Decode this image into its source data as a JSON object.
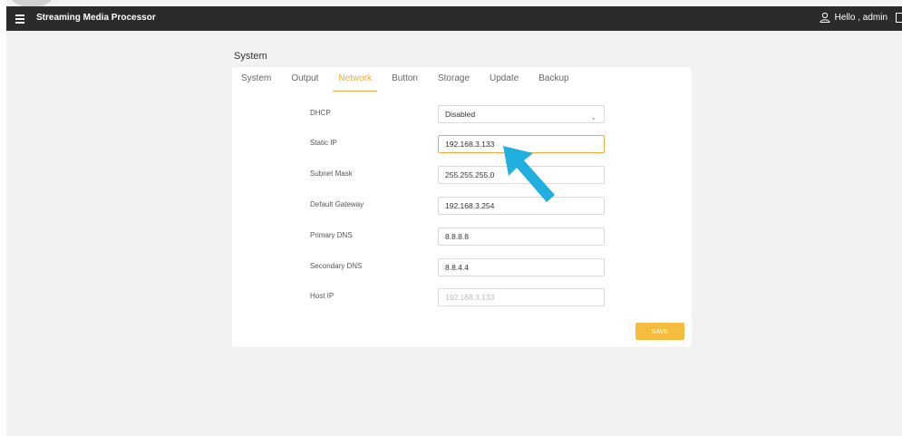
{
  "app": {
    "title": "Streaming Media Processor",
    "greeting": "Hello , admin"
  },
  "page": {
    "title": "System"
  },
  "tabs": [
    {
      "label": "System"
    },
    {
      "label": "Output"
    },
    {
      "label": "Network",
      "active": true
    },
    {
      "label": "Button"
    },
    {
      "label": "Storage"
    },
    {
      "label": "Update"
    },
    {
      "label": "Backup"
    }
  ],
  "form": {
    "dhcp": {
      "label": "DHCP",
      "value": "Disabled"
    },
    "static_ip": {
      "label": "Static IP",
      "value": "192.168.3.133"
    },
    "subnet": {
      "label": "Subnet Mask",
      "value": "255.255.255.0"
    },
    "gateway": {
      "label": "Default Gateway",
      "value": "192.168.3.254"
    },
    "dns1": {
      "label": "Primary DNS",
      "value": "8.8.8.8"
    },
    "dns2": {
      "label": "Secondary DNS",
      "value": "8.8.4.4"
    },
    "host_ip": {
      "label": "Host IP",
      "placeholder": "192.168.3.133"
    },
    "save_label": "SAVE"
  },
  "colors": {
    "accent": "#f2a93b",
    "button": "#f5bc3d",
    "topbar": "#2b2b2b",
    "annotation_arrow": "#1fb0e0"
  },
  "icons": {
    "menu": "hamburger-icon",
    "user": "user-icon",
    "dropdown": "chevron-down-icon",
    "annotation": "arrow-annotation"
  }
}
